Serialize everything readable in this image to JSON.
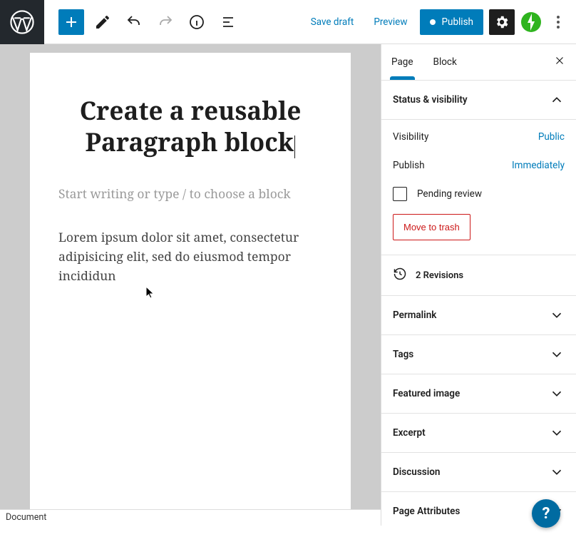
{
  "topbar": {
    "save_draft": "Save draft",
    "preview": "Preview",
    "publish": "Publish"
  },
  "editor": {
    "title": "Create a reusable Paragraph block",
    "placeholder": "Start writing or type / to choose a block",
    "paragraph": "Lorem ipsum dolor sit amet, consectetur adipisicing elit, sed do eiusmod tempor incididun"
  },
  "sidebar": {
    "tabs": {
      "page": "Page",
      "block": "Block"
    },
    "panels": {
      "status_visibility": "Status & visibility",
      "permalink": "Permalink",
      "tags": "Tags",
      "featured_image": "Featured image",
      "excerpt": "Excerpt",
      "discussion": "Discussion",
      "page_attributes": "Page Attributes"
    },
    "status": {
      "visibility_label": "Visibility",
      "visibility_value": "Public",
      "publish_label": "Publish",
      "publish_value": "Immediately",
      "pending_review": "Pending review",
      "move_to_trash": "Move to trash"
    },
    "revisions": {
      "count": "2 Revisions"
    }
  },
  "footer": {
    "breadcrumb": "Document"
  },
  "help": {
    "label": "?"
  }
}
